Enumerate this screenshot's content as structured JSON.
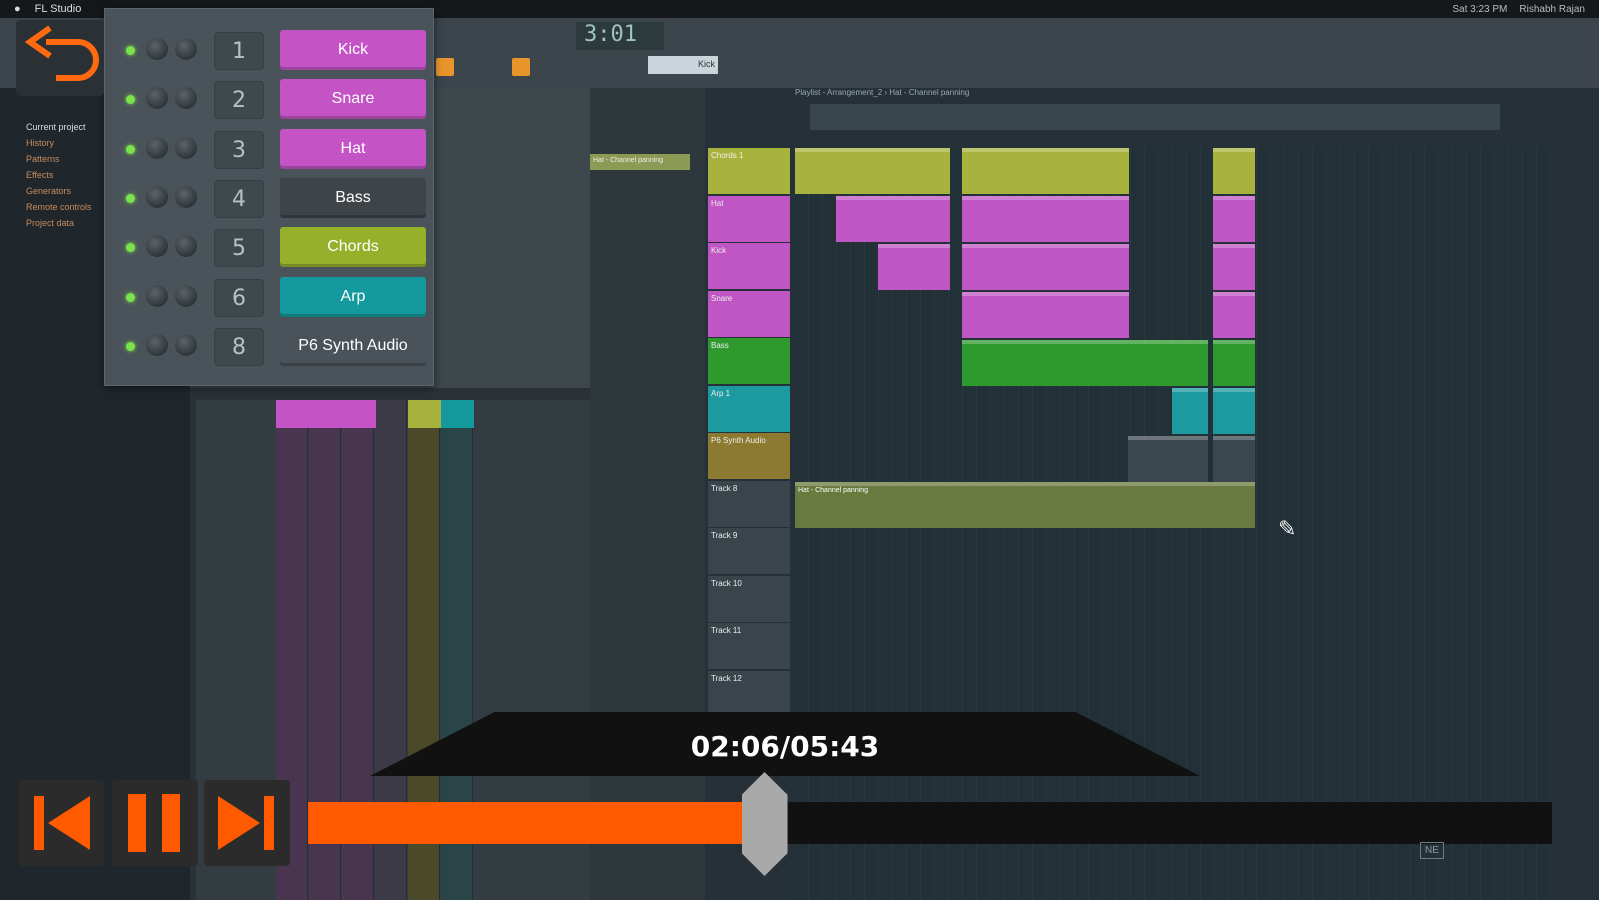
{
  "menubar": {
    "app": "FL Studio",
    "clock": "Sat 3:23 PM",
    "user": "Rishabh Rajan"
  },
  "toolbar": {
    "time": "3:01",
    "pattern": "Kick"
  },
  "browser": {
    "items": [
      "Current project",
      "History",
      "Patterns",
      "Effects",
      "Generators",
      "Remote controls",
      "Project data"
    ]
  },
  "playlist": {
    "title": "Playlist - Arrangement_2 › Hat - Channel panning",
    "automation_clip": "Hat - Channel panning",
    "tracks": [
      {
        "name": "Chords 1",
        "color": "#a7b33c"
      },
      {
        "name": "Hat",
        "color": "#c056c4"
      },
      {
        "name": "Kick",
        "color": "#c056c4"
      },
      {
        "name": "Snare",
        "color": "#c056c4"
      },
      {
        "name": "Bass",
        "color": "#2e9a2e"
      },
      {
        "name": "Arp 1",
        "color": "#1c9aa0"
      },
      {
        "name": "P6 Synth Audio",
        "color": "#8c7a30"
      },
      {
        "name": "Track 8",
        "color": "#3a454b"
      },
      {
        "name": "Track 9",
        "color": "#3a454b"
      },
      {
        "name": "Track 10",
        "color": "#3a454b"
      },
      {
        "name": "Track 11",
        "color": "#3a454b"
      },
      {
        "name": "Track 12",
        "color": "#3a454b"
      }
    ]
  },
  "channel_rack": {
    "channels": [
      {
        "num": "1",
        "name": "Kick",
        "color": "#c454c6"
      },
      {
        "num": "2",
        "name": "Snare",
        "color": "#c454c6"
      },
      {
        "num": "3",
        "name": "Hat",
        "color": "#c454c6"
      },
      {
        "num": "4",
        "name": "Bass",
        "color": "#3f4449"
      },
      {
        "num": "5",
        "name": "Chords",
        "color": "#97b02c"
      },
      {
        "num": "6",
        "name": "Arp",
        "color": "#14999e"
      },
      {
        "num": "8",
        "name": "P6 Synth Audio",
        "color": "#4a5359"
      }
    ]
  },
  "player": {
    "timecode": "02:06/05:43",
    "progress": 0.367,
    "accent": "#ff5a00"
  },
  "watermark": "NE"
}
